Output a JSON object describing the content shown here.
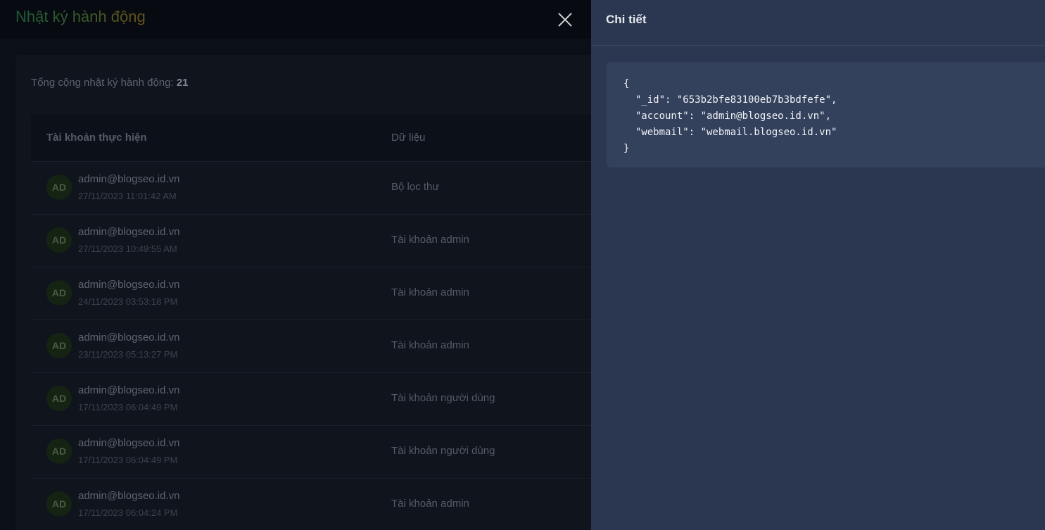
{
  "background_page": {
    "title": "Nhật ký hành động",
    "total_label": "Tổng cộng nhật ký hành động: ",
    "total_count": "21",
    "columns": {
      "account": "Tài khoản thực hiện",
      "data": "Dữ liệu"
    },
    "rows": [
      {
        "avatar": "AD",
        "account": "admin@blogseo.id.vn",
        "time": "27/11/2023 11:01:42 AM",
        "data": "Bộ lọc thư"
      },
      {
        "avatar": "AD",
        "account": "admin@blogseo.id.vn",
        "time": "27/11/2023 10:49:55 AM",
        "data": "Tài khoản admin"
      },
      {
        "avatar": "AD",
        "account": "admin@blogseo.id.vn",
        "time": "24/11/2023 03:53:18 PM",
        "data": "Tài khoản admin"
      },
      {
        "avatar": "AD",
        "account": "admin@blogseo.id.vn",
        "time": "23/11/2023 05:13:27 PM",
        "data": "Tài khoản admin"
      },
      {
        "avatar": "AD",
        "account": "admin@blogseo.id.vn",
        "time": "17/11/2023 06:04:49 PM",
        "data": "Tài khoản người dùng"
      },
      {
        "avatar": "AD",
        "account": "admin@blogseo.id.vn",
        "time": "17/11/2023 06:04:49 PM",
        "data": "Tài khoản người dùng"
      },
      {
        "avatar": "AD",
        "account": "admin@blogseo.id.vn",
        "time": "17/11/2023 06:04:24 PM",
        "data": "Tài khoản admin"
      }
    ]
  },
  "drawer": {
    "title": "Chi tiết",
    "json_lines": [
      "{",
      "  \"_id\": \"653b2bfe83100eb7b3bdfefe\",",
      "  \"account\": \"admin@blogseo.id.vn\",",
      "  \"webmail\": \"webmail.blogseo.id.vn\"",
      "}"
    ]
  },
  "icons": {
    "close": "close-icon"
  },
  "colors": {
    "drawer_bg": "#2b3750",
    "json_box_bg": "#34415d",
    "backdrop_bg": "#0b0f17"
  }
}
